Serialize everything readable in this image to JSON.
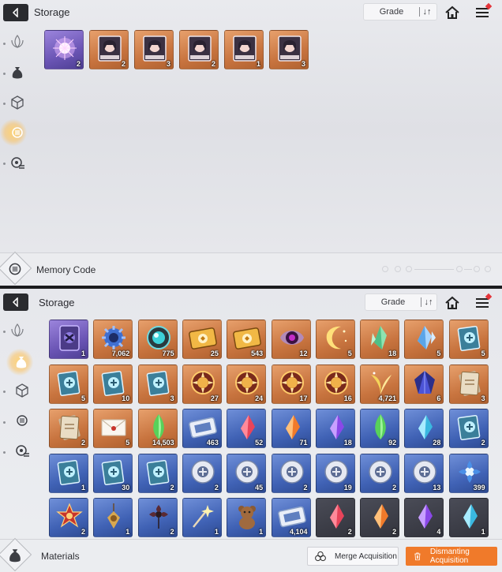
{
  "top": {
    "title": "Storage",
    "grade_label": "Grade",
    "sort_glyph": "↓↑",
    "sidebar": [
      "leaf-icon",
      "pouch-icon",
      "cube-icon",
      "memory-core-icon",
      "disc-icon"
    ],
    "selected_sidebar": "memory-core-icon",
    "items": [
      {
        "rarity": "purple",
        "icon": "magic-orb-icon",
        "count": "2"
      },
      {
        "rarity": "orange",
        "icon": "character-card-icon",
        "count": "2"
      },
      {
        "rarity": "orange",
        "icon": "character-card-icon",
        "count": "3"
      },
      {
        "rarity": "orange",
        "icon": "character-card-icon",
        "count": "2"
      },
      {
        "rarity": "orange",
        "icon": "character-card-icon",
        "count": "1"
      },
      {
        "rarity": "orange",
        "icon": "character-card-icon",
        "count": "3"
      }
    ],
    "footer_label": "Memory Code"
  },
  "bottom": {
    "title": "Storage",
    "grade_label": "Grade",
    "sort_glyph": "↓↑",
    "sidebar": [
      "leaf-icon",
      "pouch-icon",
      "cube-icon",
      "memory-core-icon",
      "disc-icon"
    ],
    "selected_sidebar": "pouch-icon",
    "footer_label": "Materials",
    "merge_label": "Merge Acquisition",
    "dismantle_label": "Dismanting Acquisition",
    "items": [
      {
        "rarity": "purple",
        "icon": "purple-card-icon",
        "count": "1"
      },
      {
        "rarity": "orange",
        "icon": "blue-gear-icon",
        "count": "7,062"
      },
      {
        "rarity": "orange",
        "icon": "teal-orb-icon",
        "count": "775"
      },
      {
        "rarity": "orange",
        "icon": "gold-ticket-icon",
        "count": "25"
      },
      {
        "rarity": "orange",
        "icon": "gold-ticket-icon",
        "count": "543"
      },
      {
        "rarity": "orange",
        "icon": "dark-eye-icon",
        "count": "12"
      },
      {
        "rarity": "orange",
        "icon": "moon-icon",
        "count": "5"
      },
      {
        "rarity": "orange",
        "icon": "green-crystal-icon",
        "count": "18"
      },
      {
        "rarity": "orange",
        "icon": "blue-crystal-icon",
        "count": "5"
      },
      {
        "rarity": "orange",
        "icon": "book-icon",
        "count": "5"
      },
      {
        "rarity": "orange",
        "icon": "book-icon",
        "count": "5"
      },
      {
        "rarity": "orange",
        "icon": "book-icon",
        "count": "10"
      },
      {
        "rarity": "orange",
        "icon": "book-icon",
        "count": "3"
      },
      {
        "rarity": "orange",
        "icon": "medal-icon",
        "count": "27"
      },
      {
        "rarity": "orange",
        "icon": "medal-icon",
        "count": "24"
      },
      {
        "rarity": "orange",
        "icon": "medal-icon",
        "count": "17"
      },
      {
        "rarity": "orange",
        "icon": "medal-icon",
        "count": "16"
      },
      {
        "rarity": "orange",
        "icon": "gold-leaf-icon",
        "count": "4,721"
      },
      {
        "rarity": "orange",
        "icon": "dark-gem-icon",
        "count": "6"
      },
      {
        "rarity": "orange",
        "icon": "card-deck-icon",
        "count": "3"
      },
      {
        "rarity": "orange",
        "icon": "card-deck-icon",
        "count": "2"
      },
      {
        "rarity": "orange",
        "icon": "letter-icon",
        "count": "5"
      },
      {
        "rarity": "orange",
        "icon": "green-shard-icon",
        "count": "14,503"
      },
      {
        "rarity": "blue",
        "icon": "ticket-icon",
        "count": "463"
      },
      {
        "rarity": "blue",
        "icon": "red-shard-icon",
        "count": "52"
      },
      {
        "rarity": "blue",
        "icon": "orange-shard-icon",
        "count": "71"
      },
      {
        "rarity": "blue",
        "icon": "purple-shard-icon",
        "count": "18"
      },
      {
        "rarity": "blue",
        "icon": "green-shard-icon",
        "count": "92"
      },
      {
        "rarity": "blue",
        "icon": "cyan-shard-icon",
        "count": "28"
      },
      {
        "rarity": "blue",
        "icon": "book-icon",
        "count": "2"
      },
      {
        "rarity": "blue",
        "icon": "book-icon",
        "count": "1"
      },
      {
        "rarity": "blue",
        "icon": "book-icon",
        "count": "30"
      },
      {
        "rarity": "blue",
        "icon": "book-icon",
        "count": "2"
      },
      {
        "rarity": "blue",
        "icon": "silver-medal-icon",
        "count": "2"
      },
      {
        "rarity": "blue",
        "icon": "silver-medal-icon",
        "count": "45"
      },
      {
        "rarity": "blue",
        "icon": "silver-medal-icon",
        "count": "2"
      },
      {
        "rarity": "blue",
        "icon": "silver-medal-icon",
        "count": "19"
      },
      {
        "rarity": "blue",
        "icon": "silver-medal-icon",
        "count": "2"
      },
      {
        "rarity": "blue",
        "icon": "silver-medal-icon",
        "count": "13"
      },
      {
        "rarity": "blue",
        "icon": "blue-flower-icon",
        "count": "399"
      },
      {
        "rarity": "blue",
        "icon": "red-medal-icon",
        "count": "2"
      },
      {
        "rarity": "blue",
        "icon": "pendant-icon",
        "count": "1"
      },
      {
        "rarity": "blue",
        "icon": "dark-flower-icon",
        "count": "2"
      },
      {
        "rarity": "blue",
        "icon": "sparkle-wand-icon",
        "count": "1"
      },
      {
        "rarity": "blue",
        "icon": "teddy-bear-icon",
        "count": "1"
      },
      {
        "rarity": "blue",
        "icon": "ticket-icon",
        "count": "4,104"
      },
      {
        "rarity": "dark",
        "icon": "red-shard-icon",
        "count": "2"
      },
      {
        "rarity": "dark",
        "icon": "orange-shard-icon",
        "count": "2"
      },
      {
        "rarity": "dark",
        "icon": "purple-shard-icon",
        "count": "4"
      },
      {
        "rarity": "dark",
        "icon": "cyan-shard-icon",
        "count": "1"
      }
    ]
  },
  "colors": {
    "accent_orange": "#f07a2a",
    "notification_red": "#e4343a",
    "selected_glow": "#ffc862"
  }
}
